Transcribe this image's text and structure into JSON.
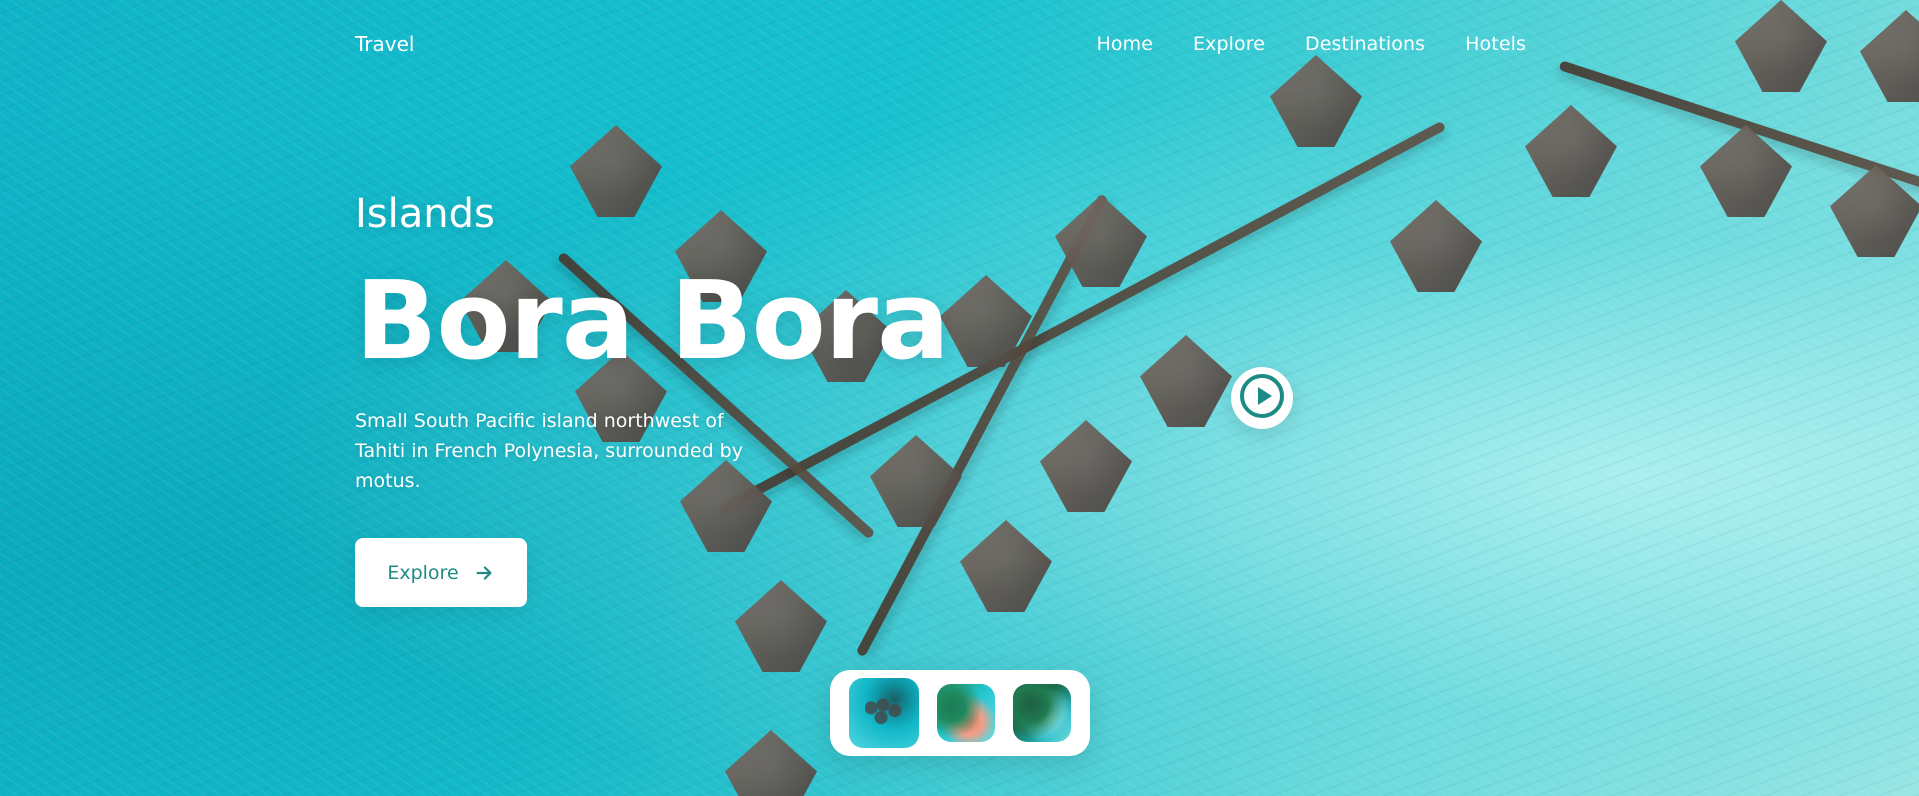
{
  "nav": {
    "brand": "Travel",
    "links": [
      "Home",
      "Explore",
      "Destinations",
      "Hotels"
    ]
  },
  "hero": {
    "subtitle": "Islands",
    "title": "Bora Bora",
    "description": "Small South Pacific island northwest of Tahiti in French Polynesia, surrounded by motus.",
    "cta_label": "Explore"
  },
  "icons": {
    "cta_arrow": "arrow-right-icon",
    "play": "play-icon"
  },
  "colors": {
    "accent": "#1d8b84",
    "button_bg": "#ffffff",
    "text": "#ffffff"
  }
}
